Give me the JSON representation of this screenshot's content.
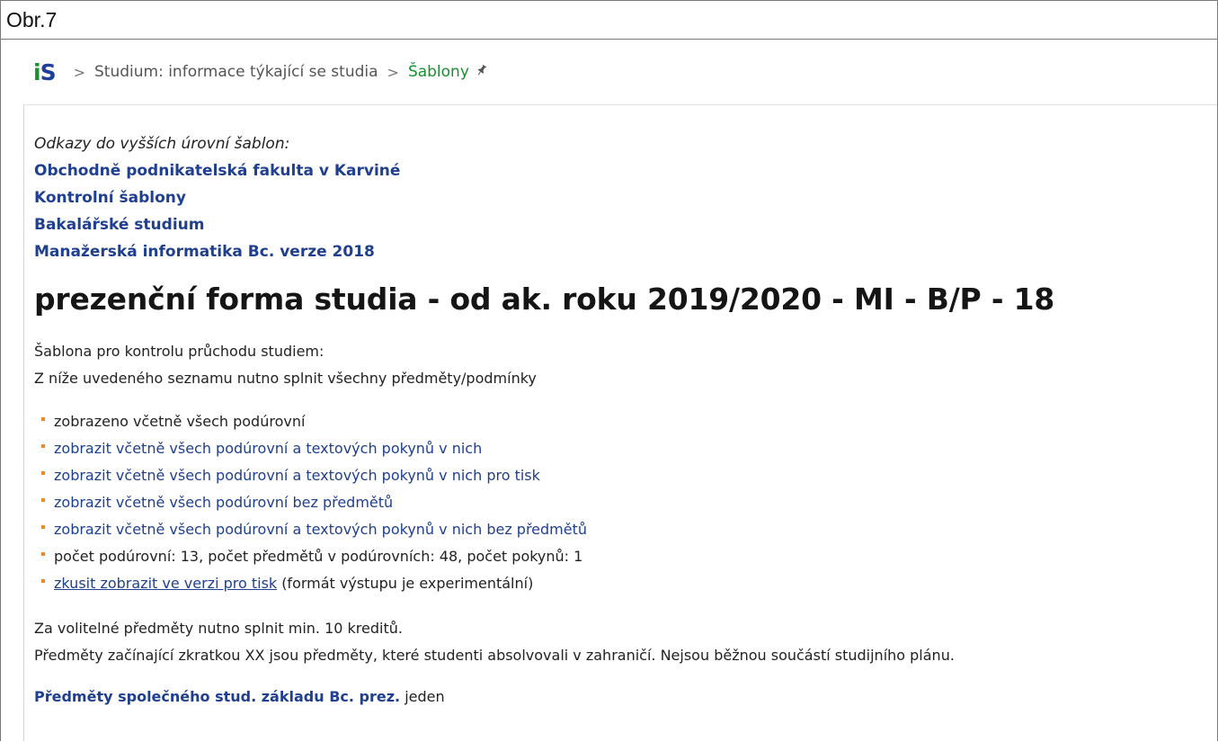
{
  "caption": "Obr.7",
  "breadcrumb": {
    "logo_i": "i",
    "logo_s": "S",
    "items": [
      "Studium: informace týkající se studia",
      "Šablony"
    ],
    "separator": ">",
    "pin_icon": "pin-icon"
  },
  "parents": {
    "intro": "Odkazy do vyšších úrovní šablon:",
    "links": [
      "Obchodně podnikatelská fakulta v Karviné",
      "Kontrolní šablony",
      "Bakalářské studium",
      "Manažerská informatika Bc. verze 2018"
    ]
  },
  "title": "prezenční forma studia - od ak. roku 2019/2020 - MI - B/P - 18",
  "lead": {
    "line1": "Šablona pro kontrolu průchodu studiem:",
    "line2": "Z níže uvedeného seznamu nutno splnit všechny předměty/podmínky"
  },
  "options": [
    "zobrazeno včetně všech podúrovní",
    "zobrazit včetně všech podúrovní a textových pokynů v nich",
    "zobrazit včetně všech podúrovní a textových pokynů v nich pro tisk",
    "zobrazit včetně všech podúrovní bez předmětů",
    "zobrazit včetně všech podúrovní a textových pokynů v nich bez předmětů",
    "počet podúrovní: 13, počet předmětů v podúrovních: 48, počet pokynů: 1",
    "zkusit zobrazit ve verzi pro tisk"
  ],
  "print_note": "(formát výstupu je experimentální)",
  "notes": {
    "line1": "Za volitelné předměty nutno splnit min. 10 kreditů.",
    "line2": "Předměty začínající zkratkou XX jsou předměty, které studenti absolvovali v zahraničí. Nejsou běžnou součástí studijního plánu."
  },
  "section": {
    "link": "Předměty společného stud. základu Bc. prez.",
    "suffix": "jeden"
  },
  "colors": {
    "link": "#1f3f8f",
    "green": "#1a8f2f",
    "bullet": "#f08a24"
  }
}
